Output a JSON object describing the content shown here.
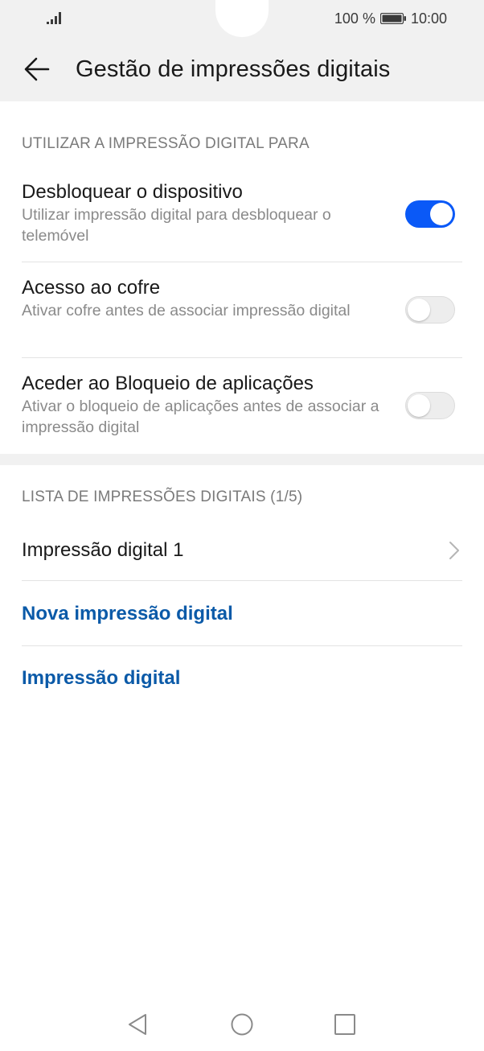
{
  "status_bar": {
    "battery_percent": "100 %",
    "time": "10:00",
    "icons": [
      "signal-icon",
      "battery-icon"
    ]
  },
  "header": {
    "title": "Gestão de impressões digitais",
    "back_icon": "back-arrow-icon"
  },
  "section_use": {
    "header": "UTILIZAR A IMPRESSÃO DIGITAL PARA",
    "items": [
      {
        "title": "Desbloquear o dispositivo",
        "subtitle": "Utilizar impressão digital para desbloquear o telemóvel",
        "enabled": true
      },
      {
        "title": "Acesso ao cofre",
        "subtitle": "Ativar cofre antes de associar impressão digital",
        "enabled": false
      },
      {
        "title": "Aceder ao Bloqueio de aplicações",
        "subtitle": "Ativar o bloqueio de aplicações antes de associar a impressão digital",
        "enabled": false
      }
    ]
  },
  "section_list": {
    "header": "LISTA DE IMPRESSÕES DIGITAIS (1/5)",
    "fingerprint_item": "Impressão digital 1",
    "new_fingerprint": "Nova impressão digital",
    "fingerprint_link": "Impressão digital"
  },
  "nav_bar": {
    "icons": [
      "nav-back-icon",
      "nav-home-icon",
      "nav-recent-icon"
    ]
  },
  "colors": {
    "accent": "#0a59f7",
    "link": "#0b5aa8",
    "background_grey": "#f1f1f1"
  }
}
